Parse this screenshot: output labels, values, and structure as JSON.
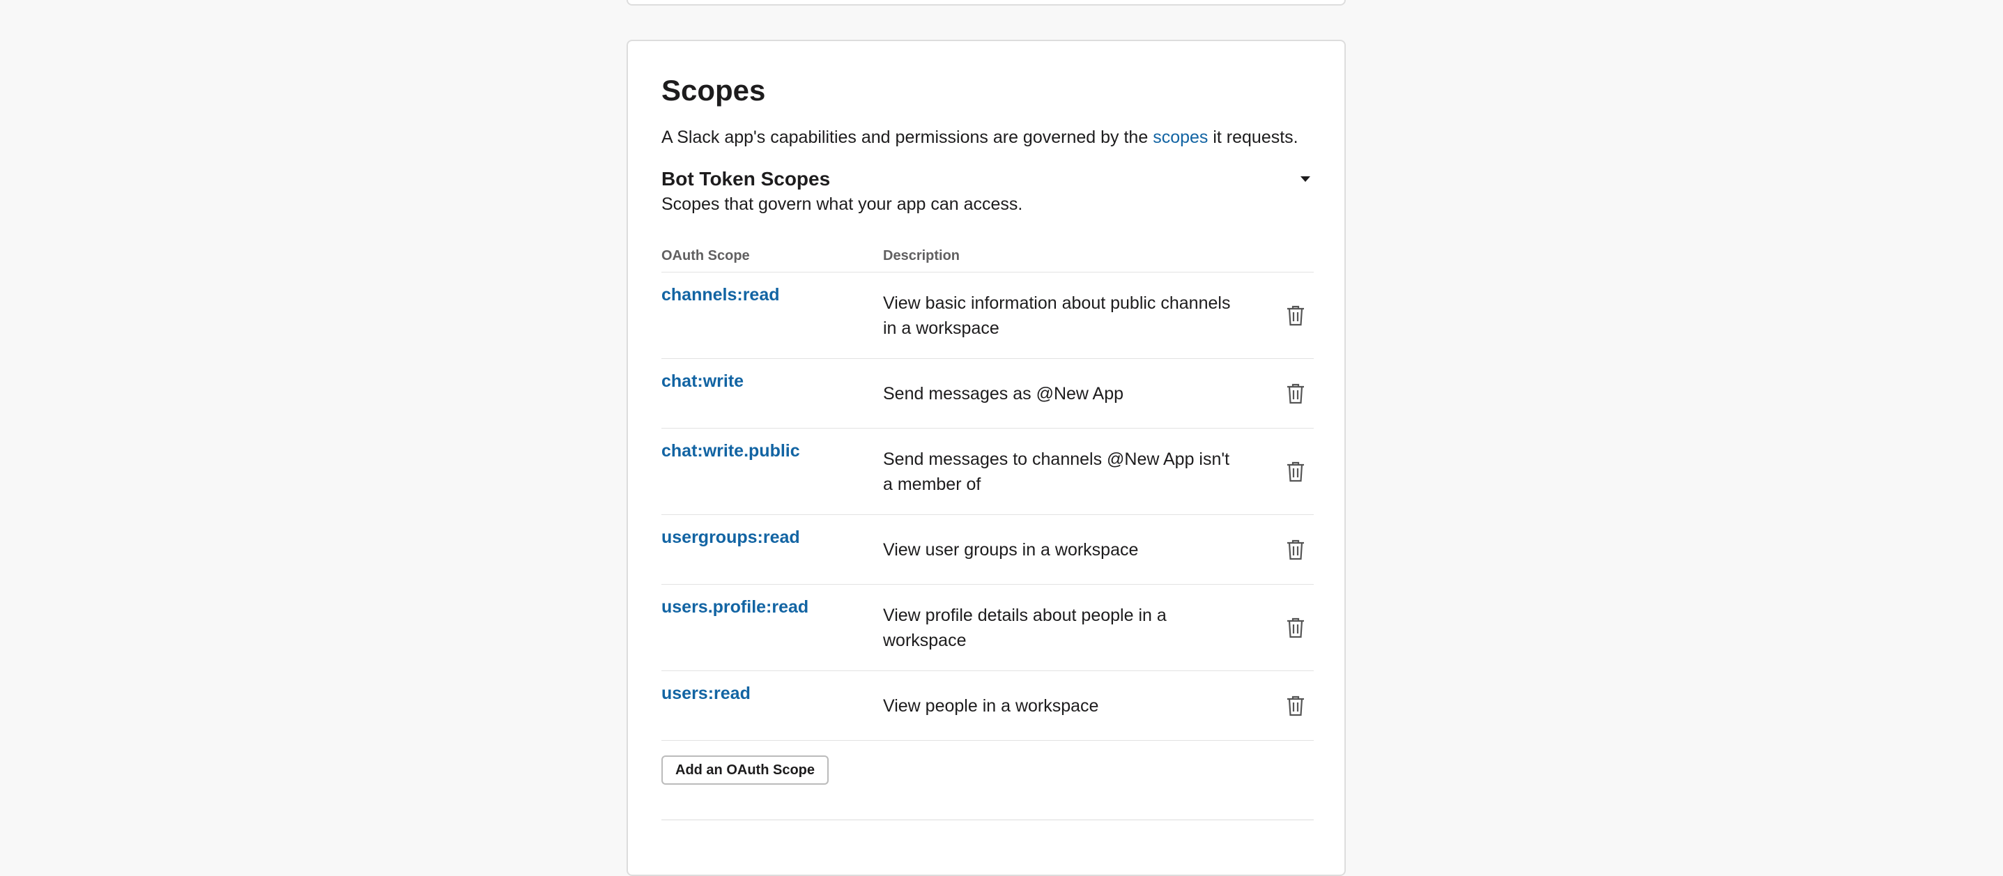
{
  "scopes_card": {
    "title": "Scopes",
    "intro_before": "A Slack app's capabilities and permissions are governed by the ",
    "intro_link": "scopes",
    "intro_after": " it requests."
  },
  "bot_token_scopes": {
    "title": "Bot Token Scopes",
    "subtitle": "Scopes that govern what your app can access.",
    "collapse_icon": "caret-down-icon",
    "table": {
      "headers": [
        "OAuth Scope",
        "Description"
      ],
      "rows": [
        {
          "scope": "channels:read",
          "description": "View basic information about public channels in a workspace"
        },
        {
          "scope": "chat:write",
          "description": "Send messages as @New App"
        },
        {
          "scope": "chat:write.public",
          "description": "Send messages to channels @New App isn't a member of"
        },
        {
          "scope": "usergroups:read",
          "description": "View user groups in a workspace"
        },
        {
          "scope": "users.profile:read",
          "description": "View profile details about people in a workspace"
        },
        {
          "scope": "users:read",
          "description": "View people in a workspace"
        }
      ],
      "row_action_icon": "trash-icon"
    },
    "add_button_label": "Add an OAuth Scope"
  },
  "colors": {
    "page_background": "#f8f8f8",
    "card_background": "#ffffff",
    "link": "#1264a3",
    "text": "#1d1c1d",
    "muted_text": "#616061",
    "border": "#dddddd"
  }
}
